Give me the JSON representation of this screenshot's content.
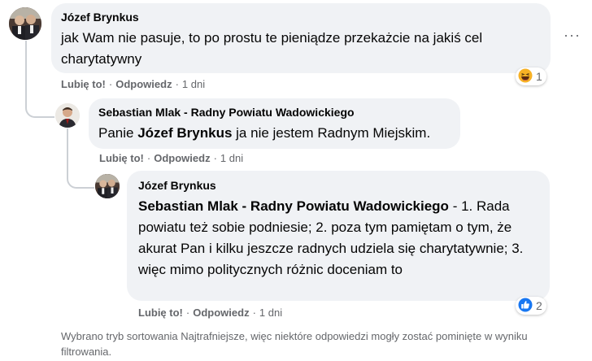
{
  "comments": [
    {
      "author": "Józef Brynkus",
      "text": "jak Wam nie pasuje, to po prostu te pieniądze przekażcie na jakiś cel charytatywny",
      "actions": {
        "like": "Lubię to!",
        "reply": "Odpowiedz",
        "time": "1 dni"
      },
      "reaction": {
        "icon": "haha-emoji-icon",
        "count": "1"
      }
    },
    {
      "author": "Sebastian Mlak - Radny Powiatu Wadowickiego",
      "text_prefix": "Panie",
      "mention": "Józef Brynkus",
      "text_suffix": "ja nie jestem Radnym Miejskim.",
      "actions": {
        "like": "Lubię to!",
        "reply": "Odpowiedz",
        "time": "1 dni"
      }
    },
    {
      "author": "Józef Brynkus",
      "mention": "Sebastian Mlak - Radny Powiatu Wadowickiego",
      "text": "- 1. Rada powiatu też sobie podniesie; 2. poza tym pamiętam o tym, że akurat Pan i kilku jeszcze radnych udziela się charytatywnie; 3. więc mimo politycznych różnic doceniam to",
      "actions": {
        "like": "Lubię to!",
        "reply": "Odpowiedz",
        "time": "1 dni"
      },
      "reaction": {
        "icon": "like-thumb-icon",
        "count": "2"
      }
    }
  ],
  "more_options": "···",
  "footer_note": "Wybrano tryb sortowania Najtrafniejsze, więc niektóre odpowiedzi mogły zostać pominięte w wyniku filtrowania.",
  "colors": {
    "bubble": "#f0f2f5",
    "meta_text": "#65676b",
    "like_blue": "#1877f2",
    "haha_yellow": "#f7b125"
  }
}
